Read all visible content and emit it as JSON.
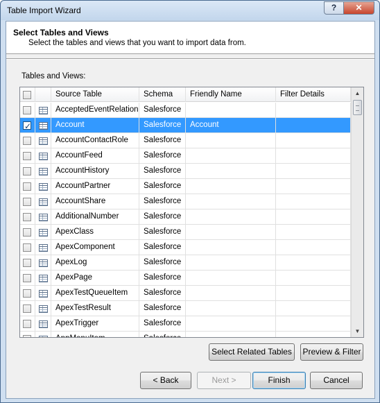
{
  "window": {
    "title": "Table Import Wizard",
    "help_label": "?",
    "close_label": "✕"
  },
  "header": {
    "title": "Select Tables and Views",
    "description": "Select the tables and views that you want to import data from."
  },
  "grid": {
    "label": "Tables and Views:",
    "columns": [
      "Source Table",
      "Schema",
      "Friendly Name",
      "Filter Details"
    ],
    "rows": [
      {
        "checked": false,
        "source": "AcceptedEventRelation",
        "schema": "Salesforce",
        "friendly": "",
        "filter": ""
      },
      {
        "checked": true,
        "source": "Account",
        "schema": "Salesforce",
        "friendly": "Account",
        "filter": ""
      },
      {
        "checked": false,
        "source": "AccountContactRole",
        "schema": "Salesforce",
        "friendly": "",
        "filter": ""
      },
      {
        "checked": false,
        "source": "AccountFeed",
        "schema": "Salesforce",
        "friendly": "",
        "filter": ""
      },
      {
        "checked": false,
        "source": "AccountHistory",
        "schema": "Salesforce",
        "friendly": "",
        "filter": ""
      },
      {
        "checked": false,
        "source": "AccountPartner",
        "schema": "Salesforce",
        "friendly": "",
        "filter": ""
      },
      {
        "checked": false,
        "source": "AccountShare",
        "schema": "Salesforce",
        "friendly": "",
        "filter": ""
      },
      {
        "checked": false,
        "source": "AdditionalNumber",
        "schema": "Salesforce",
        "friendly": "",
        "filter": ""
      },
      {
        "checked": false,
        "source": "ApexClass",
        "schema": "Salesforce",
        "friendly": "",
        "filter": ""
      },
      {
        "checked": false,
        "source": "ApexComponent",
        "schema": "Salesforce",
        "friendly": "",
        "filter": ""
      },
      {
        "checked": false,
        "source": "ApexLog",
        "schema": "Salesforce",
        "friendly": "",
        "filter": ""
      },
      {
        "checked": false,
        "source": "ApexPage",
        "schema": "Salesforce",
        "friendly": "",
        "filter": ""
      },
      {
        "checked": false,
        "source": "ApexTestQueueItem",
        "schema": "Salesforce",
        "friendly": "",
        "filter": ""
      },
      {
        "checked": false,
        "source": "ApexTestResult",
        "schema": "Salesforce",
        "friendly": "",
        "filter": ""
      },
      {
        "checked": false,
        "source": "ApexTrigger",
        "schema": "Salesforce",
        "friendly": "",
        "filter": ""
      },
      {
        "checked": false,
        "source": "AppMenuItem",
        "schema": "Salesforce",
        "friendly": "",
        "filter": ""
      }
    ],
    "selected_row": 1
  },
  "buttons": {
    "select_related": "Select Related Tables",
    "preview_filter": "Preview & Filter",
    "back": "< Back",
    "next": "Next >",
    "finish": "Finish",
    "cancel": "Cancel"
  },
  "colors": {
    "selection": "#3399ff",
    "frame": "#cfdff0",
    "close": "#c7452d"
  }
}
